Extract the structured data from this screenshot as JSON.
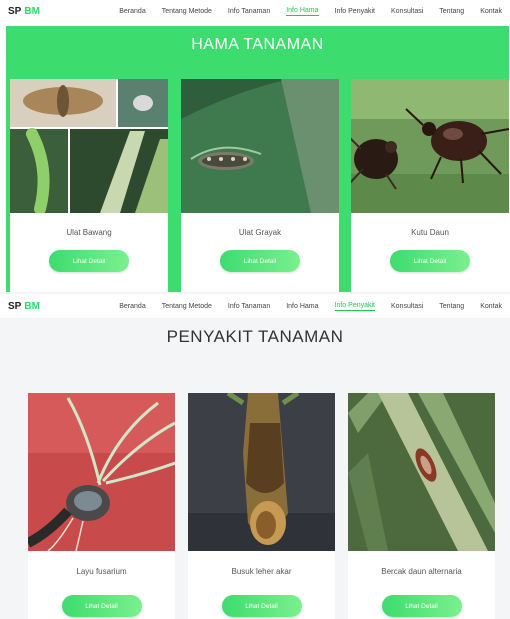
{
  "screens": [
    {
      "brand": {
        "sp": "SP",
        "bm": "BM"
      },
      "menu": [
        {
          "label": "Beranda",
          "active": false
        },
        {
          "label": "Tentang Metode",
          "active": false
        },
        {
          "label": "Info Tanaman",
          "active": false
        },
        {
          "label": "Info Hama",
          "active": true
        },
        {
          "label": "Info Penyakit",
          "active": false
        },
        {
          "label": "Konsultasi",
          "active": false
        },
        {
          "label": "Tentang",
          "active": false
        },
        {
          "label": "Kontak",
          "active": false
        }
      ],
      "title": "HAMA TANAMAN",
      "cards": [
        {
          "name": "Ulat Bawang",
          "button": "Lihat Detail"
        },
        {
          "name": "Ulat Grayak",
          "button": "Lihat Detail"
        },
        {
          "name": "Kutu Daun",
          "button": "Lihat Detail"
        }
      ]
    },
    {
      "brand": {
        "sp": "SP",
        "bm": "BM"
      },
      "menu": [
        {
          "label": "Beranda",
          "active": false
        },
        {
          "label": "Tentang Metode",
          "active": false
        },
        {
          "label": "Info Tanaman",
          "active": false
        },
        {
          "label": "Info Hama",
          "active": false
        },
        {
          "label": "Info Penyakit",
          "active": true
        },
        {
          "label": "Konsultasi",
          "active": false
        },
        {
          "label": "Tentang",
          "active": false
        },
        {
          "label": "Kontak",
          "active": false
        }
      ],
      "title": "PENYAKIT TANAMAN",
      "cards": [
        {
          "name": "Layu fusarium",
          "button": "Lihat Detail"
        },
        {
          "name": "Busuk leher akar",
          "button": "Lihat Detail"
        },
        {
          "name": "Bercak daun alternaria",
          "button": "Lihat Detail"
        }
      ]
    }
  ],
  "colors": {
    "accent": "#3ddc6e",
    "brand_bm": "#2fd86a",
    "active_link": "#22c55e"
  }
}
